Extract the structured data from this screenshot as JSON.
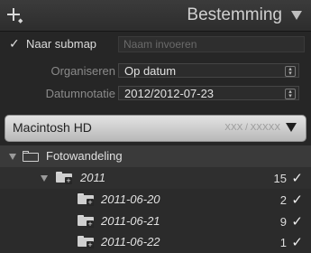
{
  "header": {
    "title": "Bestemming"
  },
  "settings": {
    "subfolder_label": "Naar submap",
    "subfolder_checked": true,
    "subfolder_placeholder": "Naam invoeren",
    "organize_label": "Organiseren",
    "organize_value": "Op datum",
    "date_format_label": "Datumnotatie",
    "date_format_value": "2012/2012-07-23"
  },
  "volume": {
    "name": "Macintosh HD",
    "free_text": "XXX / XXXXX"
  },
  "tree": {
    "root": {
      "label": "Fotowandeling"
    },
    "year": {
      "label": "2011",
      "count": "15"
    },
    "dates": [
      {
        "label": "2011-06-20",
        "count": "2"
      },
      {
        "label": "2011-06-21",
        "count": "9"
      },
      {
        "label": "2011-06-22",
        "count": "1"
      }
    ],
    "check_glyph": "✓"
  },
  "colors": {
    "panel_bg": "#262626",
    "header_bg": "#333333",
    "volume_bg": "#d0d0d0",
    "text": "#e0e0e0"
  },
  "icons": [
    "plus-icon",
    "collapse-triangle-icon",
    "checkbox-icon",
    "select-arrows-icon",
    "dropdown-triangle-icon",
    "folder-icon",
    "new-folder-icon",
    "checkmark-icon"
  ]
}
